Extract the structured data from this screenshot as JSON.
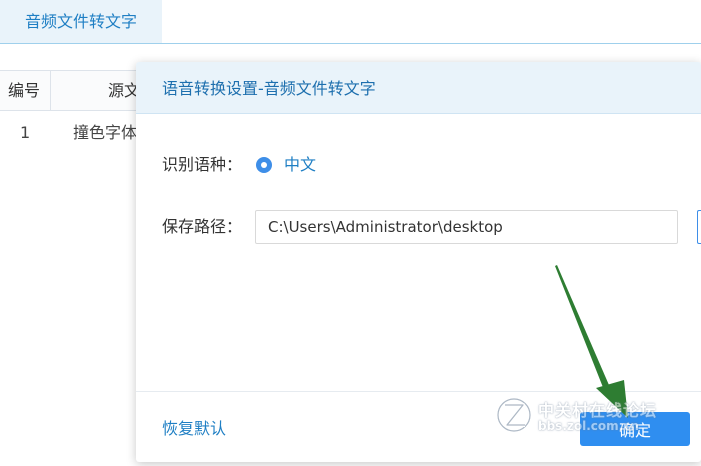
{
  "tabs": [
    {
      "label": "音频文件转文字",
      "active": true
    }
  ],
  "table": {
    "columns": [
      "编号",
      "源文"
    ],
    "rows": [
      {
        "index": "1",
        "source": "撞色字体"
      }
    ]
  },
  "dialog": {
    "title": "语音转换设置-音频文件转文字",
    "language": {
      "label": "识别语种：",
      "options": [
        {
          "label": "中文",
          "selected": true
        }
      ]
    },
    "save_path": {
      "label": "保存路径：",
      "value": "C:\\Users\\Administrator\\desktop"
    },
    "reset_label": "恢复默认",
    "confirm_label": "确定"
  },
  "watermark": {
    "text_cn": "中关村在线论坛",
    "text_en": "bbs.zol.com.cn"
  },
  "colors": {
    "accent": "#2f8ef0",
    "link": "#1f7fc4",
    "header_bg": "#e9f3fa",
    "annotation_arrow": "#2e7d32"
  },
  "icons": {
    "radio": "radio-selected-icon",
    "annotation": "arrow-pointer-icon",
    "watermark_logo": "zol-logo-icon"
  }
}
